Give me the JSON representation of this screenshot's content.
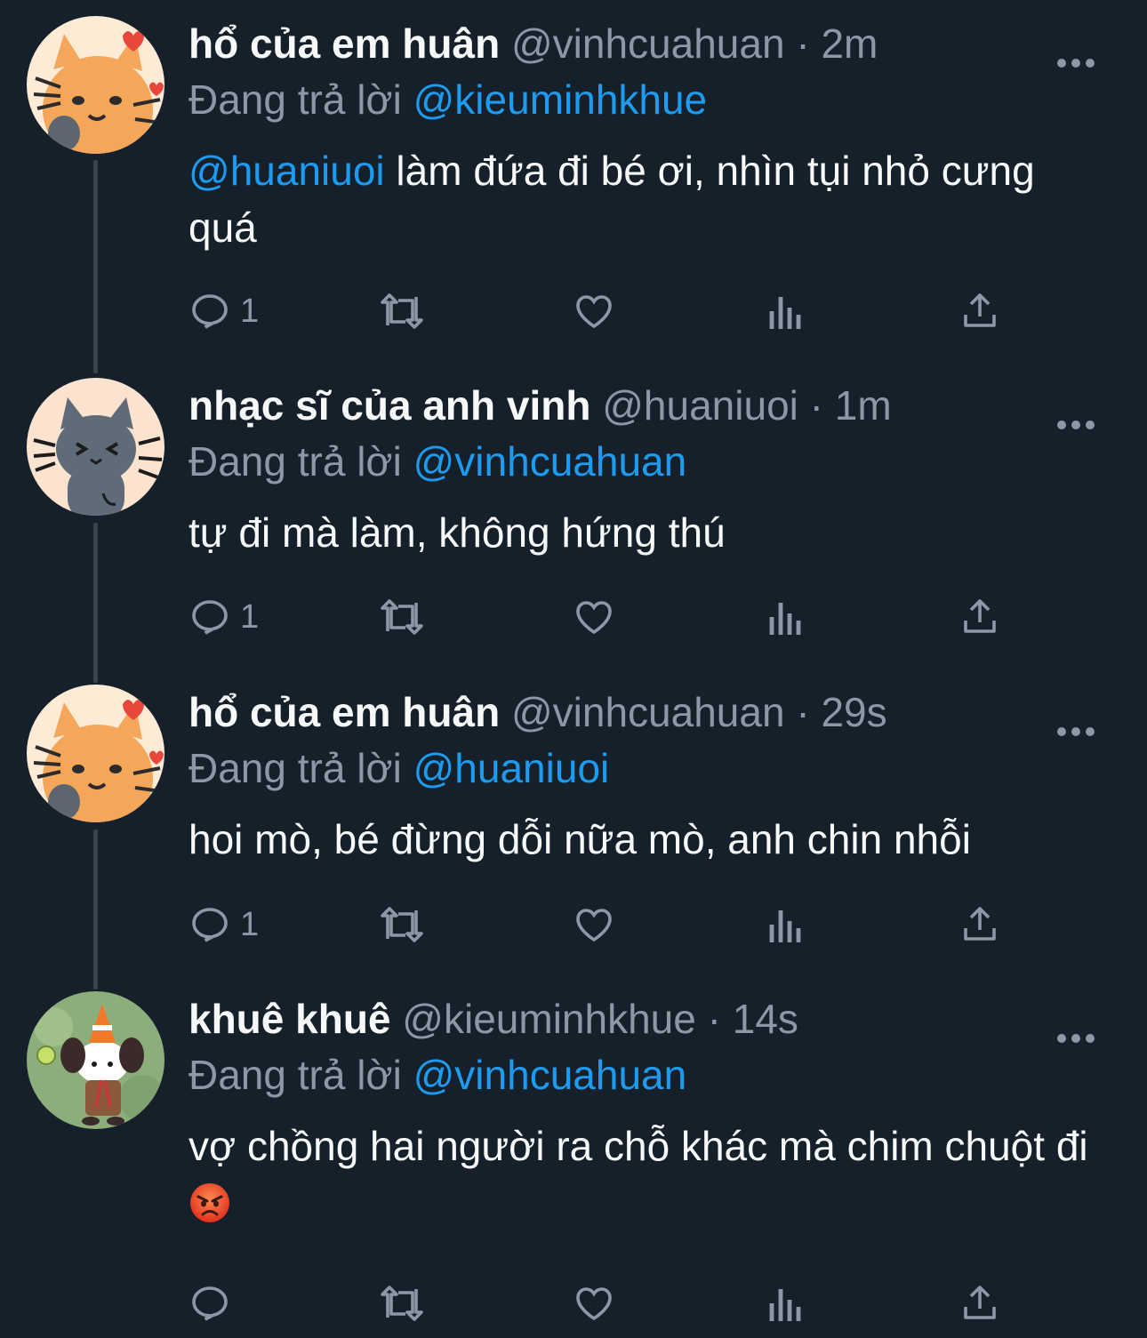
{
  "replying_label": "Đang trả lời",
  "tweets": [
    {
      "display_name": "hổ của em huân",
      "handle": "@vinhcuahuan",
      "separator": "·",
      "time": "2m",
      "reply_to": "@kieuminhkhue",
      "mention": "@huaniuoi",
      "text": "làm đứa đi bé ơi, nhìn tụi nhỏ cưng quá",
      "reply_count": "1",
      "avatar_icon": "orange-cat-avatar"
    },
    {
      "display_name": "nhạc sĩ của anh vinh",
      "handle": "@huaniuoi",
      "separator": "·",
      "time": "1m",
      "reply_to": "@vinhcuahuan",
      "mention": "",
      "text": "tự đi mà làm, không hứng thú",
      "reply_count": "1",
      "avatar_icon": "grey-cat-avatar"
    },
    {
      "display_name": "hổ của em huân",
      "handle": "@vinhcuahuan",
      "separator": "·",
      "time": "29s",
      "reply_to": "@huaniuoi",
      "mention": "",
      "text": "hoi mò, bé đừng dỗi nữa mò, anh chin nhỗi",
      "reply_count": "1",
      "avatar_icon": "orange-cat-avatar"
    },
    {
      "display_name": "khuê khuê",
      "handle": "@kieuminhkhue",
      "separator": "·",
      "time": "14s",
      "reply_to": "@vinhcuahuan",
      "mention": "",
      "text": "vợ chồng hai người ra chỗ khác mà chim chuột đi",
      "reply_count": "",
      "avatar_icon": "puppy-traffic-cone-avatar",
      "trailing_emoji": "angry-face-emoji"
    }
  ],
  "colors": {
    "background": "#15202b",
    "primary_text": "#f7f9f9",
    "secondary_text": "#8b98a5",
    "link": "#1d9bf0",
    "thread_line": "#38444d"
  }
}
